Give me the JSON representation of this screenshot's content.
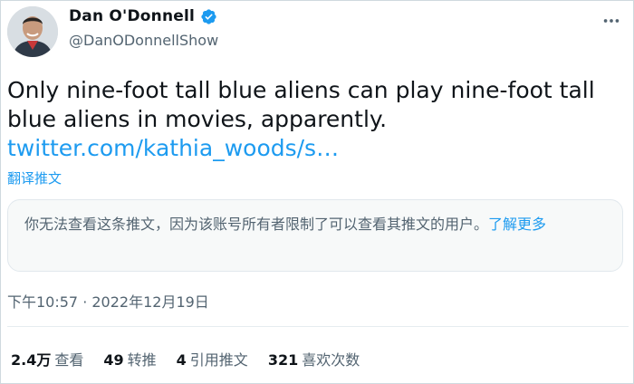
{
  "author": {
    "display_name": "Dan O'Donnell",
    "handle": "@DanODonnellShow",
    "verified_icon": "verified-badge-icon",
    "more_icon": "more-horizontal-icon"
  },
  "tweet": {
    "text": "Only nine-foot tall blue aliens can play nine-foot tall blue aliens in movies, apparently.",
    "link": "twitter.com/kathia_woods/s…",
    "translate_label": "翻译推文"
  },
  "notice": {
    "text": "你无法查看这条推文，因为该账号所有者限制了可以查看其推文的用户。",
    "learn_more": "了解更多"
  },
  "timestamp": "下午10:57 · 2022年12月19日",
  "stats": [
    {
      "value": "2.4万",
      "label": "查看"
    },
    {
      "value": "49",
      "label": "转推"
    },
    {
      "value": "4",
      "label": "引用推文"
    },
    {
      "value": "321",
      "label": "喜欢次数"
    }
  ],
  "colors": {
    "accent": "#1d9bf0",
    "text": "#0f1419",
    "secondary": "#536471"
  }
}
